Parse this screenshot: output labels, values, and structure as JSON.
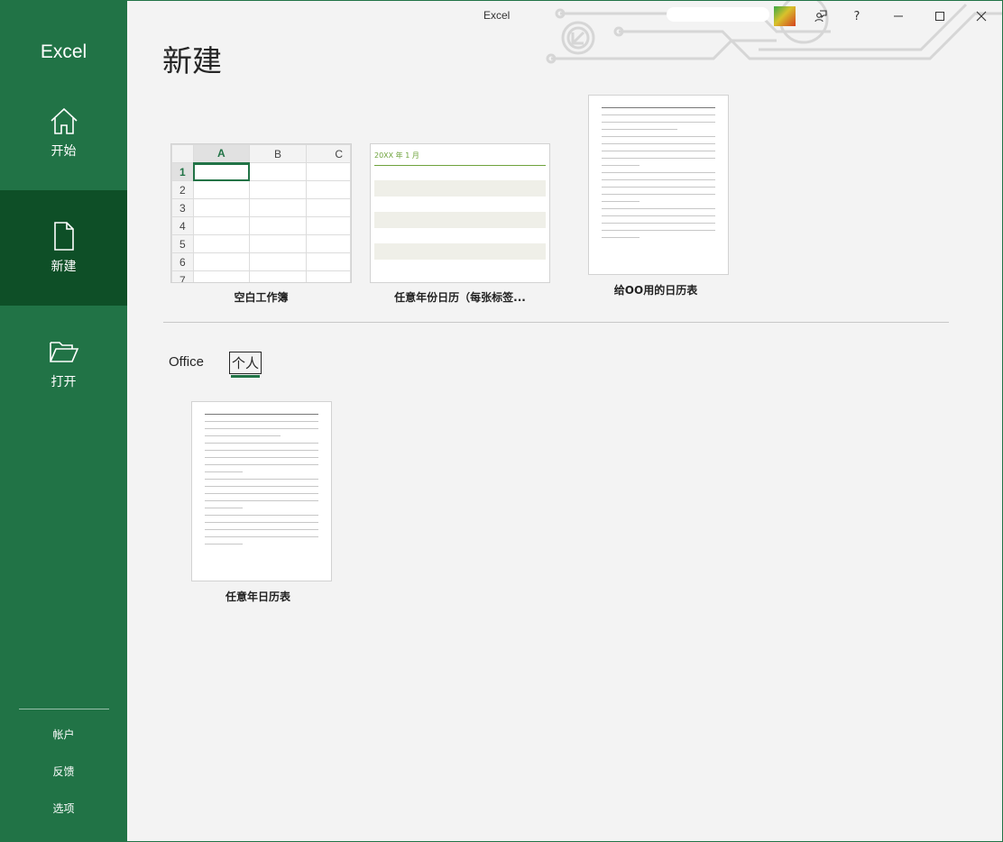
{
  "sidebar": {
    "app_name": "Excel",
    "nav": [
      {
        "label": "开始",
        "icon": "home-icon"
      },
      {
        "label": "新建",
        "icon": "new-document-icon",
        "active": true
      },
      {
        "label": "打开",
        "icon": "open-folder-icon"
      }
    ],
    "bottom": [
      {
        "label": "帐户"
      },
      {
        "label": "反馈"
      },
      {
        "label": "选项"
      }
    ]
  },
  "titlebar": {
    "title": "Excel",
    "buttons": [
      {
        "icon": "feedback-person-icon"
      },
      {
        "icon": "help-icon",
        "label": "?"
      },
      {
        "icon": "minimize-icon"
      },
      {
        "icon": "maximize-icon"
      },
      {
        "icon": "close-icon"
      }
    ]
  },
  "page": {
    "title": "新建",
    "featured_templates": [
      {
        "label": "空白工作簿",
        "type": "blank-workbook"
      },
      {
        "label": "任意年份日历（每张标签...",
        "type": "calendar",
        "calendar_heading": "20XX 年 1 月"
      },
      {
        "label": "给OO用的日历表",
        "type": "document"
      }
    ],
    "blank_grid": {
      "columns": [
        "A",
        "B",
        "C"
      ],
      "rows": [
        "1",
        "2",
        "3",
        "4",
        "5",
        "6",
        "7"
      ]
    },
    "tabs": [
      {
        "label": "Office"
      },
      {
        "label": "个人",
        "active": true
      }
    ],
    "personal_templates": [
      {
        "label": "任意年日历表",
        "type": "document"
      }
    ]
  },
  "colors": {
    "accent": "#217346",
    "accent_dark": "#0e4f27",
    "background": "#f3f3f3"
  }
}
